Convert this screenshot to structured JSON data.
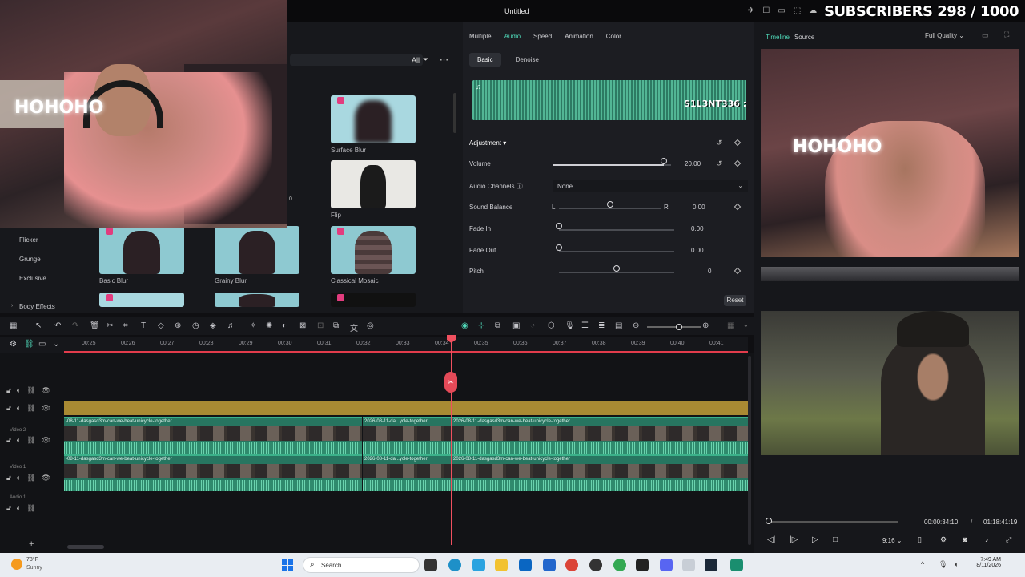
{
  "window": {
    "title": "Untitled"
  },
  "overlay": {
    "subscribers": "SUBSCRIBERS 298 / 1000",
    "wave_tag": "S1L3NT336 :",
    "neon_text": "HOHOHO"
  },
  "effects": {
    "filter_all": "All",
    "side_items": [
      "Flicker",
      "Grunge",
      "Exclusive",
      "Body Effects"
    ],
    "thumbs": [
      {
        "label": "Surface Blur"
      },
      {
        "label": "Flip"
      },
      {
        "label": "Basic Blur"
      },
      {
        "label": "Grainy Blur"
      },
      {
        "label": "Classical Mosaic"
      }
    ],
    "side_counter": "0"
  },
  "properties": {
    "tabs": [
      "Multiple",
      "Audio",
      "Speed",
      "Animation",
      "Color"
    ],
    "active_tab": "Audio",
    "subtabs": [
      "Basic",
      "Denoise"
    ],
    "section": "Adjustment",
    "volume": {
      "label": "Volume",
      "value": "20.00",
      "level": 0.94
    },
    "channels": {
      "label": "Audio Channels",
      "value": "None"
    },
    "balance": {
      "label": "Sound Balance",
      "left": "L",
      "right": "R",
      "value": "0.00",
      "level": 0.5
    },
    "fade_in": {
      "label": "Fade In",
      "value": "0.00",
      "level": 0
    },
    "fade_out": {
      "label": "Fade Out",
      "value": "0.00",
      "level": 0
    },
    "pitch": {
      "label": "Pitch",
      "value": "0",
      "level": 0.5
    },
    "reset": "Reset"
  },
  "preview": {
    "tabs": [
      "Timeline",
      "Source"
    ],
    "quality": "Full Quality",
    "current_time": "00:00:34:10",
    "separator": "/",
    "total_time": "01:18:41:19",
    "ratio": "9:16"
  },
  "timeline": {
    "ticks": [
      "00:25",
      "00:26",
      "00:27",
      "00:28",
      "00:29",
      "00:30",
      "00:31",
      "00:32",
      "00:33",
      "00:34",
      "00:35",
      "00:36",
      "00:37",
      "00:38",
      "00:39",
      "00:40",
      "00:41"
    ],
    "tracks": [
      "Video 2",
      "Video 1",
      "Audio 1"
    ],
    "clip_long": "-08-11-dasgasd3m-can-we-beat-unicycle-together",
    "clip_short": "2026-08-11-da...ycle-together",
    "clip_right": "2026-08-11-dasgasd3m-can-we-beat-unicycle-together"
  },
  "taskbar": {
    "temp": "78°F",
    "weather": "Sunny",
    "search": "Search",
    "time": "7:49 AM",
    "date": "8/11/2026"
  }
}
